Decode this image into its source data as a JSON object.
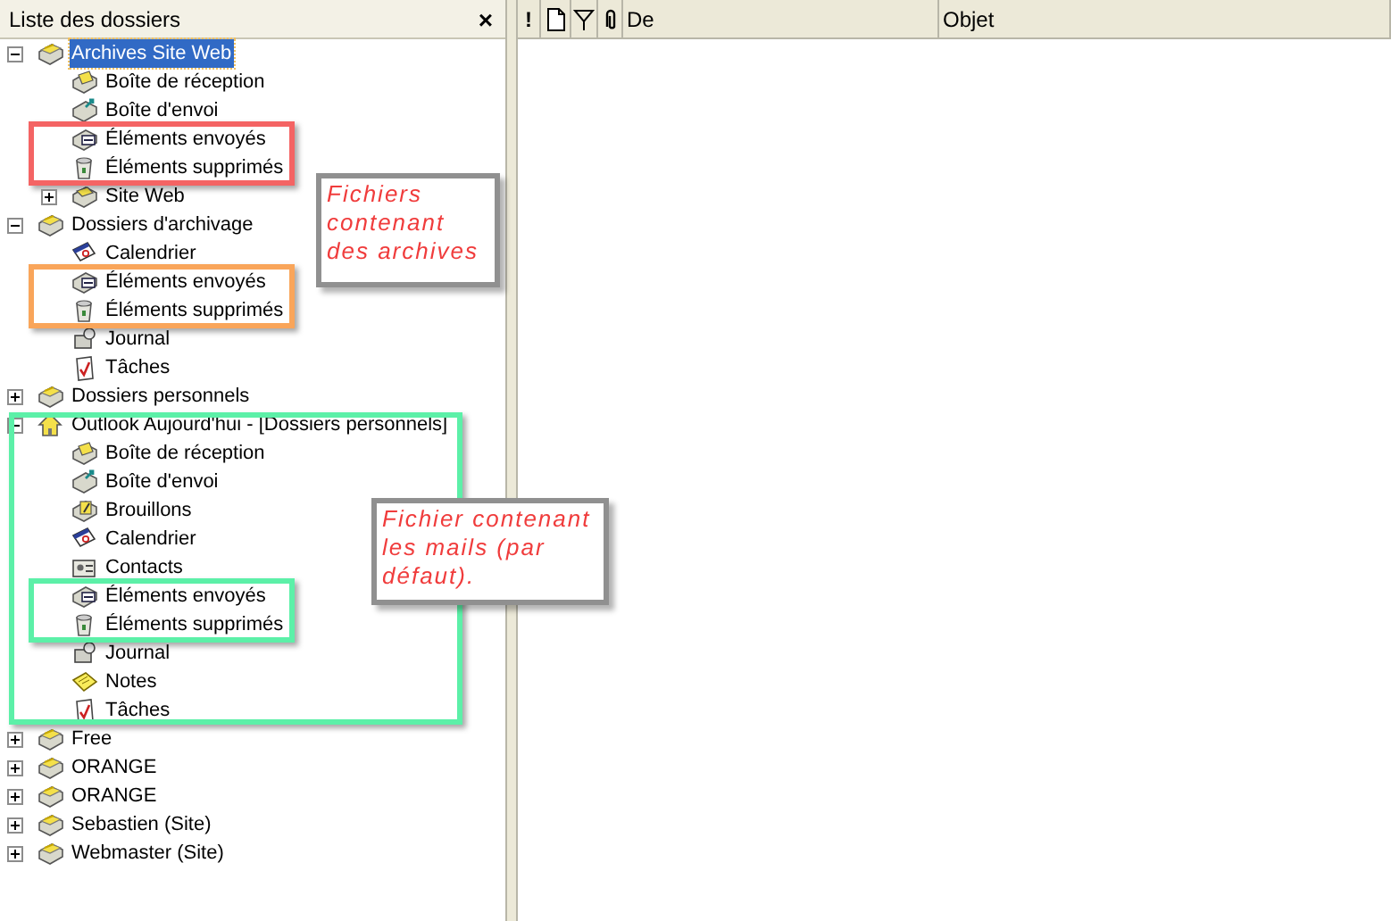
{
  "folder_pane": {
    "title": "Liste des dossiers",
    "close": "×"
  },
  "tree": [
    {
      "label": "Archives Site Web",
      "kind": "root",
      "selected": true,
      "expanded": true,
      "children": [
        {
          "label": "Boîte de réception",
          "kind": "inbox",
          "selected": false
        },
        {
          "label": "Boîte d'envoi",
          "kind": "outbox",
          "selected": false
        },
        {
          "label": "Éléments envoyés",
          "kind": "sent",
          "selected": false,
          "color": "#f46464"
        },
        {
          "label": "Éléments supprimés",
          "kind": "deleted",
          "selected": false,
          "color": "#f46464"
        },
        {
          "label": "Site Web",
          "kind": "folder",
          "selected": false,
          "expanded": false
        }
      ]
    },
    {
      "label": "Dossiers d'archivage",
      "kind": "root",
      "selected": false,
      "expanded": true,
      "children": [
        {
          "label": "Calendrier",
          "kind": "calendar",
          "selected": false
        },
        {
          "label": "Éléments envoyés",
          "kind": "sent",
          "selected": false,
          "color": "#f9a55a"
        },
        {
          "label": "Éléments supprimés",
          "kind": "deleted",
          "selected": false,
          "color": "#f9a55a"
        },
        {
          "label": "Journal",
          "kind": "journal",
          "selected": false
        },
        {
          "label": "Tâches",
          "kind": "tasks",
          "selected": false
        }
      ]
    },
    {
      "label": "Dossiers personnels",
      "kind": "root",
      "selected": false,
      "expanded": false
    },
    {
      "label": "Outlook Aujourd'hui - [Dossiers personnels]",
      "kind": "today",
      "selected": false,
      "expanded": true,
      "color": "#5cf0a8",
      "children": [
        {
          "label": "Boîte de réception",
          "kind": "inbox",
          "selected": false
        },
        {
          "label": "Boîte d'envoi",
          "kind": "outbox",
          "selected": false
        },
        {
          "label": "Brouillons",
          "kind": "drafts",
          "selected": false
        },
        {
          "label": "Calendrier",
          "kind": "calendar",
          "selected": false
        },
        {
          "label": "Contacts",
          "kind": "contacts",
          "selected": false
        },
        {
          "label": "Éléments envoyés",
          "kind": "sent",
          "selected": false,
          "color": "#5cf0a8"
        },
        {
          "label": "Éléments supprimés",
          "kind": "deleted",
          "selected": false,
          "color": "#5cf0a8"
        },
        {
          "label": "Journal",
          "kind": "journal",
          "selected": false
        },
        {
          "label": "Notes",
          "kind": "notes",
          "selected": false
        },
        {
          "label": "Tâches",
          "kind": "tasks",
          "selected": false
        }
      ]
    },
    {
      "label": "Free",
      "kind": "root",
      "selected": false,
      "expanded": false
    },
    {
      "label": "ORANGE",
      "kind": "root",
      "selected": false,
      "expanded": false
    },
    {
      "label": "ORANGE",
      "kind": "root",
      "selected": false,
      "expanded": false
    },
    {
      "label": "Sebastien (Site)",
      "kind": "root",
      "selected": false,
      "expanded": false
    },
    {
      "label": "Webmaster (Site)",
      "kind": "root",
      "selected": false,
      "expanded": false
    }
  ],
  "message_list": {
    "columns": [
      {
        "kind": "importance",
        "label": "!"
      },
      {
        "kind": "icon"
      },
      {
        "kind": "flag"
      },
      {
        "kind": "attachment"
      },
      {
        "kind": "text",
        "label": "De"
      },
      {
        "kind": "text",
        "label": "Objet"
      }
    ]
  },
  "notes": [
    {
      "text": "Fichiers\ncontenant\ndes archives"
    },
    {
      "text": "Fichier contenant\nles mails (par\ndéfaut)."
    }
  ]
}
